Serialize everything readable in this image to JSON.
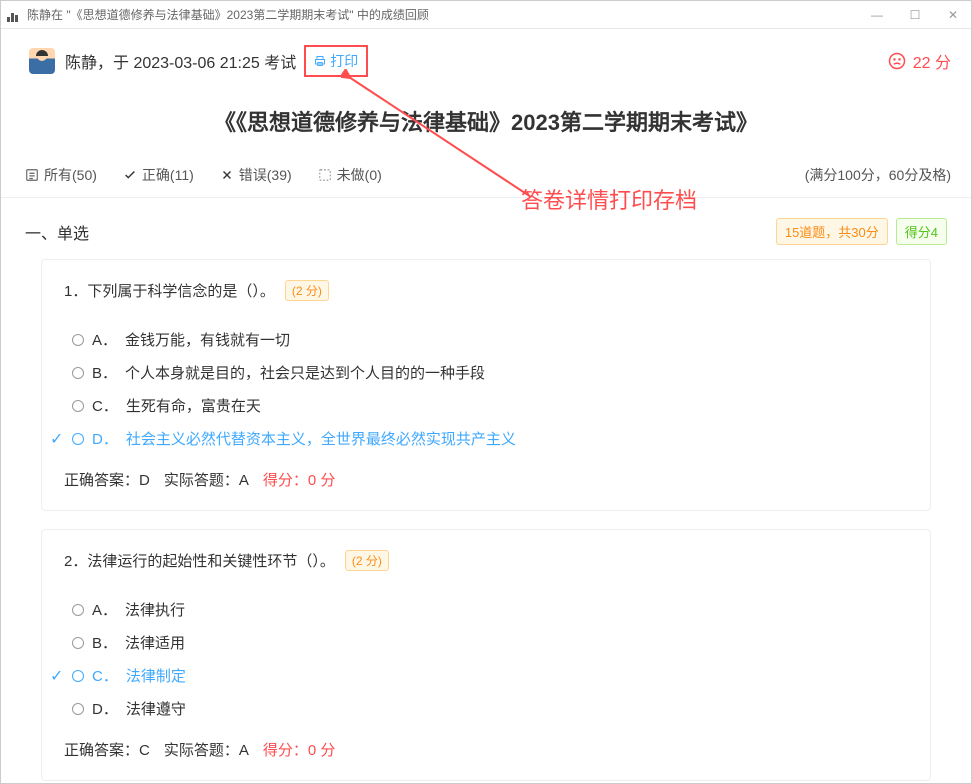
{
  "titlebar": {
    "text": "陈静在 \"《思想道德修养与法律基础》2023第二学期期末考试\" 中的成绩回顾"
  },
  "header": {
    "student_prefix": "陈静，于 2023-03-06 21:25 考试",
    "print_label": "打印",
    "score_text": "22 分"
  },
  "main_title": "《《思想道德修养与法律基础》2023第二学期期末考试》",
  "tabs": {
    "all": "所有(50)",
    "correct": "正确(11)",
    "wrong": "错误(39)",
    "undone": "未做(0)",
    "full_score": "(满分100分，60分及格)"
  },
  "section": {
    "title": "一、单选",
    "badge_count": "15道题，共30分",
    "badge_score": "得分4"
  },
  "annotation": "答卷详情打印存档",
  "questions": [
    {
      "num": "1．",
      "text": "下列属于科学信念的是（）。",
      "pts": "(2 分)",
      "options": [
        {
          "label": "A．",
          "text": "金钱万能，有钱就有一切",
          "selected": false
        },
        {
          "label": "B．",
          "text": "个人本身就是目的，社会只是达到个人目的的一种手段",
          "selected": false
        },
        {
          "label": "C．",
          "text": "生死有命，富贵在天",
          "selected": false
        },
        {
          "label": "D．",
          "text": "社会主义必然代替资本主义，全世界最终必然实现共产主义",
          "selected": true
        }
      ],
      "correct_label": "正确答案：D",
      "actual_label": "实际答题：A",
      "score_label": "得分：0 分"
    },
    {
      "num": "2．",
      "text": "法律运行的起始性和关键性环节（）。",
      "pts": "(2 分)",
      "options": [
        {
          "label": "A．",
          "text": "法律执行",
          "selected": false
        },
        {
          "label": "B．",
          "text": "法律适用",
          "selected": false
        },
        {
          "label": "C．",
          "text": "法律制定",
          "selected": true
        },
        {
          "label": "D．",
          "text": "法律遵守",
          "selected": false
        }
      ],
      "correct_label": "正确答案：C",
      "actual_label": "实际答题：A",
      "score_label": "得分：0 分"
    }
  ]
}
